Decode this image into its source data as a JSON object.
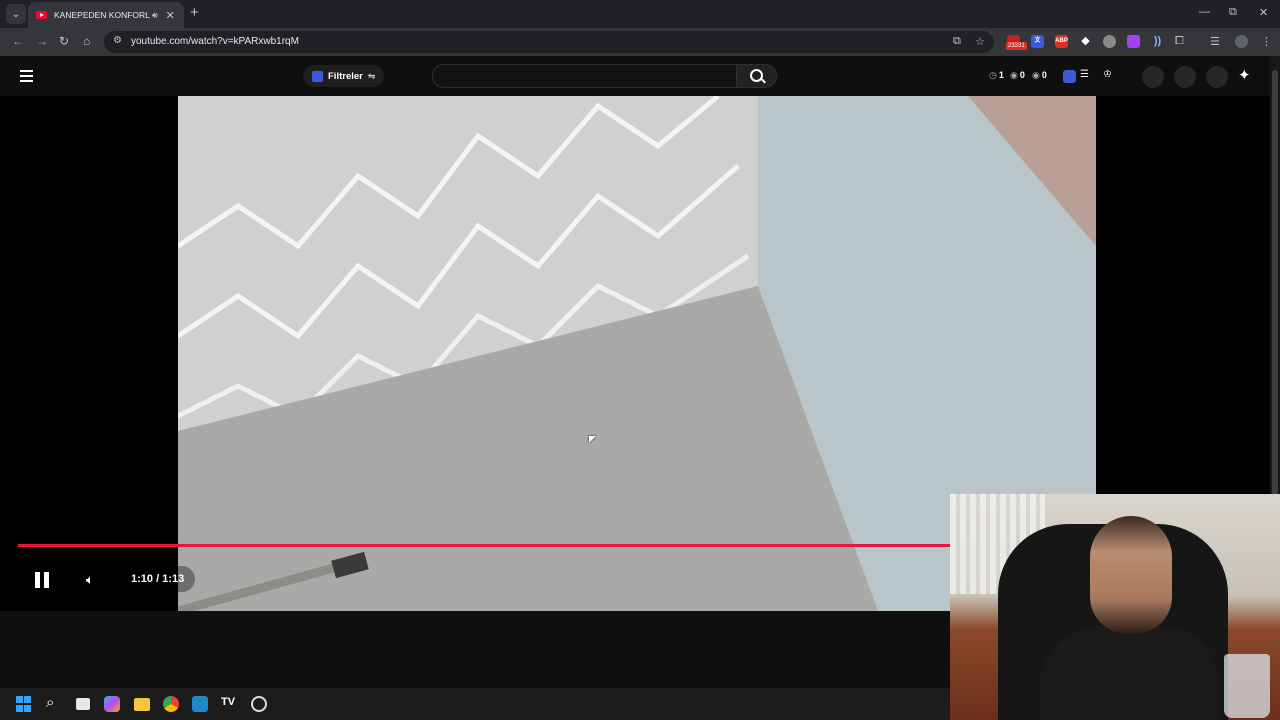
{
  "browser": {
    "tab_title": "KANEPEDEN KONFORLU V...",
    "url": "youtube.com/watch?v=kPARxwb1rqM",
    "extension_badge": "23331"
  },
  "youtube": {
    "filter_label": "Filtreler",
    "stats": {
      "history": "1",
      "views": "0",
      "watching": "0"
    }
  },
  "player": {
    "time": "1:10 / 1:13",
    "progress": 0.96,
    "state": "playing"
  },
  "colors": {
    "progress_red": "#e5173f",
    "youtube_red": "#ff0033"
  }
}
